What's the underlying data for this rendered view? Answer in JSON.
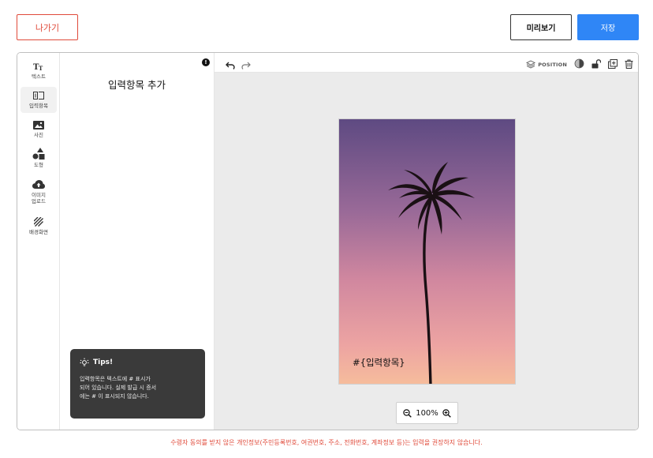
{
  "header": {
    "exit_label": "나가기",
    "preview_label": "미리보기",
    "save_label": "저장"
  },
  "toolbar": {
    "tools": [
      {
        "label": "텍스트",
        "icon": "text-icon",
        "active": false
      },
      {
        "label": "입력항목",
        "icon": "input-field-icon",
        "active": true
      },
      {
        "label": "사진",
        "icon": "image-icon",
        "active": false
      },
      {
        "label": "도형",
        "icon": "shapes-icon",
        "active": false
      },
      {
        "label": "이미지\n업로드",
        "icon": "cloud-upload-icon",
        "active": false
      },
      {
        "label": "배경화면",
        "icon": "background-pattern-icon",
        "active": false
      }
    ]
  },
  "panel": {
    "title": "입력항목 추가",
    "tips": {
      "title": "Tips!",
      "body": "입력항목은 텍스트에 # 표시가\n되어 있습니다. 실제 발급 시 증서\n에는 # 이 표시되지 않습니다."
    }
  },
  "canvas": {
    "position_label": "POSITION",
    "photo_text": "#{입력항목}",
    "zoom_value": "100%"
  },
  "footer": {
    "notice": "수령자 동의를 받지 않은 개인정보(주민등록번호, 여권번호, 주소, 전화번호, 계좌정보 등)는 입력을 권장하지 않습니다."
  },
  "colors": {
    "accent": "#2f86f6",
    "danger": "#e04a3a",
    "tips_bg": "#3a3a3a"
  }
}
